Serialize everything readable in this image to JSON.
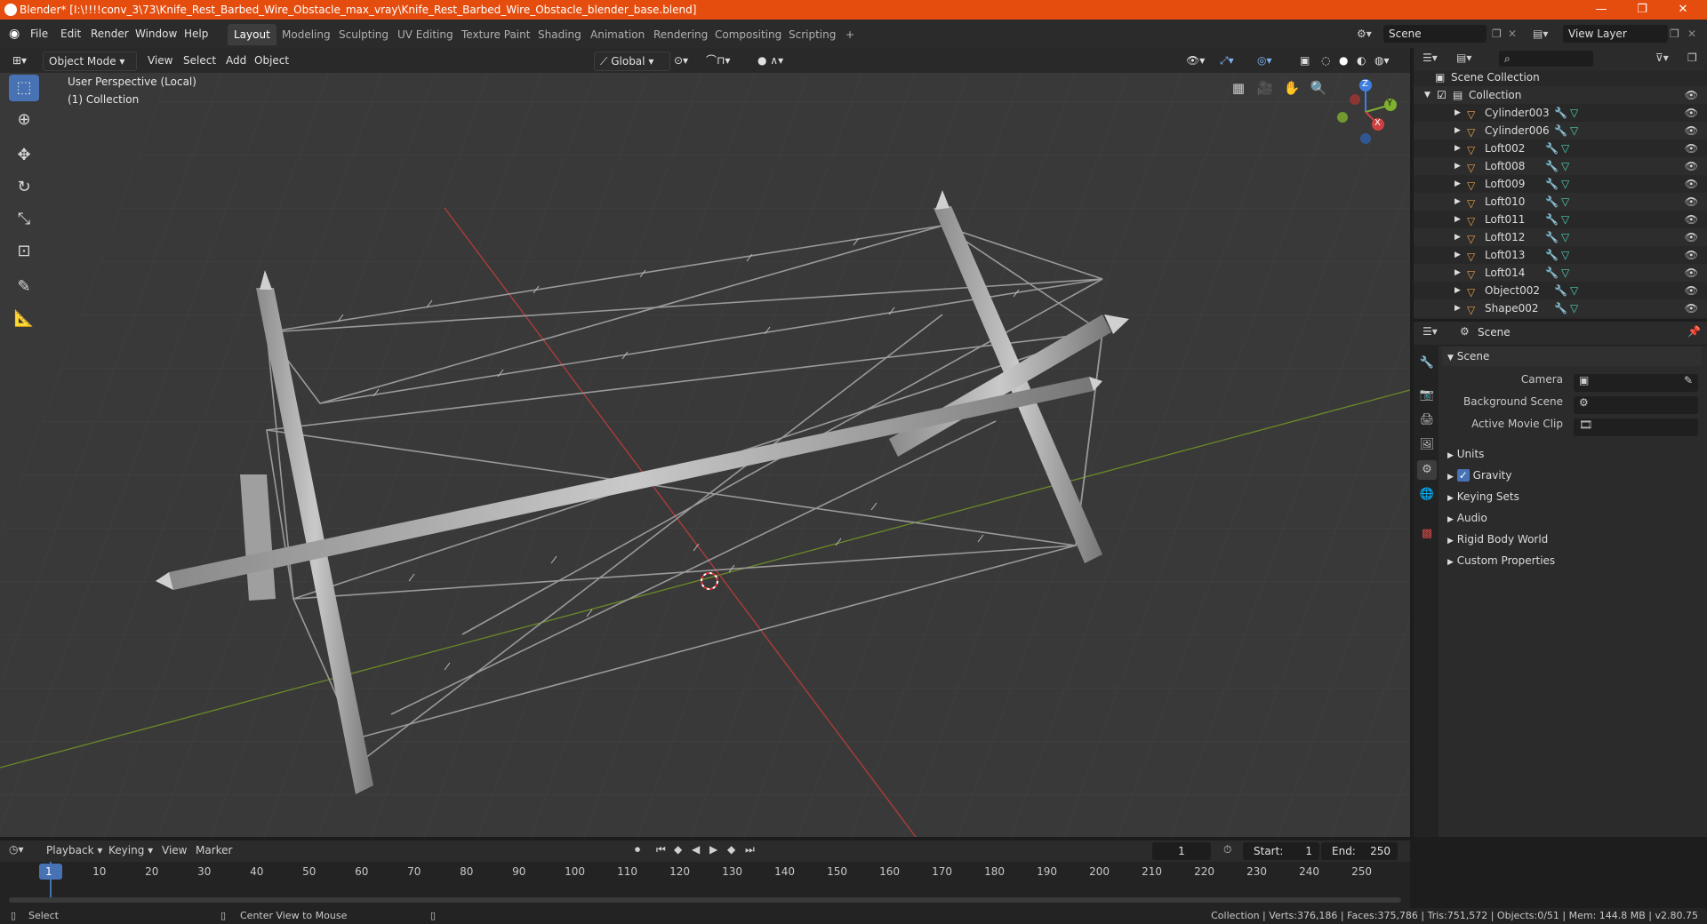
{
  "window": {
    "title": "Blender* [I:\\!!!!conv_3\\73\\Knife_Rest_Barbed_Wire_Obstacle_max_vray\\Knife_Rest_Barbed_Wire_Obstacle_blender_base.blend]",
    "controls": [
      "—",
      "❐",
      "✕"
    ]
  },
  "menus": [
    "File",
    "Edit",
    "Render",
    "Window",
    "Help"
  ],
  "workspaces": [
    "Layout",
    "Modeling",
    "Sculpting",
    "UV Editing",
    "Texture Paint",
    "Shading",
    "Animation",
    "Rendering",
    "Compositing",
    "Scripting",
    "+"
  ],
  "active_workspace": "Layout",
  "scene_field": "Scene",
  "view_layer_field": "View Layer",
  "viewport_header": {
    "mode": "Object Mode",
    "items": [
      "View",
      "Select",
      "Add",
      "Object"
    ],
    "transform": "Global"
  },
  "viewport_overlay": {
    "line1": "User Perspective (Local)",
    "line2": "(1) Collection"
  },
  "gizmo": {
    "z": "Z",
    "y": "Y",
    "x": "X"
  },
  "outliner": {
    "root": "Scene Collection",
    "collection": "Collection",
    "items": [
      "Cylinder003",
      "Cylinder006",
      "Loft002",
      "Loft008",
      "Loft009",
      "Loft010",
      "Loft011",
      "Loft012",
      "Loft013",
      "Loft014",
      "Object002",
      "Shape002"
    ]
  },
  "properties": {
    "header": "Scene",
    "panel": "Scene",
    "fields": [
      {
        "label": "Camera"
      },
      {
        "label": "Background Scene"
      },
      {
        "label": "Active Movie Clip"
      }
    ],
    "sections": [
      "Units",
      "Gravity",
      "Keying Sets",
      "Audio",
      "Rigid Body World",
      "Custom Properties"
    ]
  },
  "timeline": {
    "menus": [
      "Playback",
      "Keying",
      "View",
      "Marker"
    ],
    "current_frame": "1",
    "start_label": "Start:",
    "start": "1",
    "end_label": "End:",
    "end": "250",
    "ruler": [
      "1",
      "10",
      "20",
      "30",
      "40",
      "50",
      "60",
      "70",
      "80",
      "90",
      "100",
      "110",
      "120",
      "130",
      "140",
      "150",
      "160",
      "170",
      "180",
      "190",
      "200",
      "210",
      "220",
      "230",
      "240",
      "250"
    ]
  },
  "statusbar": {
    "left1": "Select",
    "left2": "Center View to Mouse",
    "right": "Collection | Verts:376,186 | Faces:375,786 | Tris:751,572 | Objects:0/51 | Mem: 144.8 MB | v2.80.75"
  },
  "colors": {
    "titlebar": "#e54d0f",
    "accent": "#4772b3",
    "x_axis": "#c83c3c",
    "y_axis": "#7fa52f"
  }
}
